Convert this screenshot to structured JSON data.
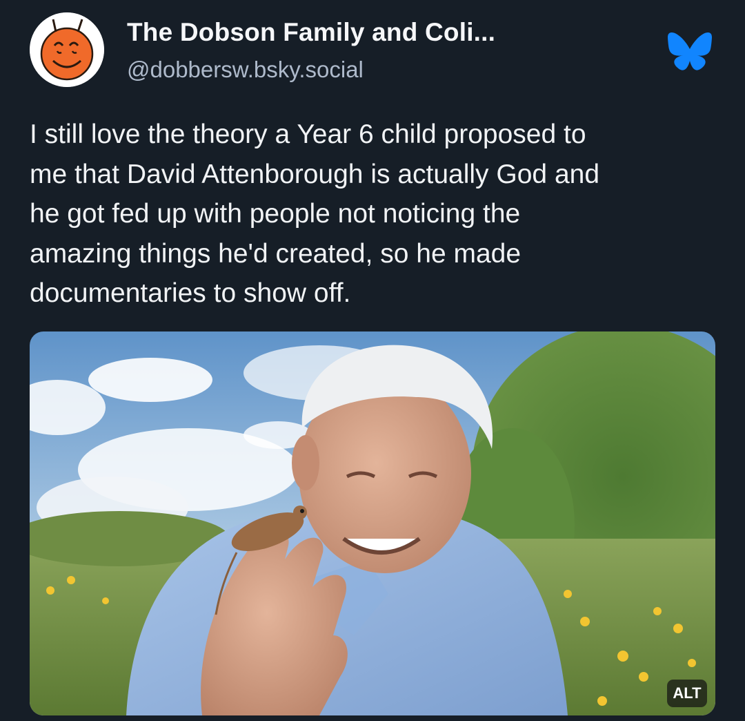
{
  "author": {
    "display_name": "The Dobson Family and Coli...",
    "handle": "@dobbersw.bsky.social",
    "avatar_icon": "cartoon-face-avatar"
  },
  "platform_icon": "bluesky-butterfly-icon",
  "post": {
    "text_lines": [
      "I still love the theory a Year 6 child proposed to",
      "me that David Attenborough is actually God and",
      "he got fed up with people not noticing the",
      "amazing things he'd created, so he made",
      "documentaries to show off."
    ]
  },
  "media": {
    "alt_label": "ALT"
  },
  "colors": {
    "background": "#161e27",
    "text": "#f1f3f5",
    "handle": "#aebacb",
    "bluesky": "#1185fe"
  }
}
